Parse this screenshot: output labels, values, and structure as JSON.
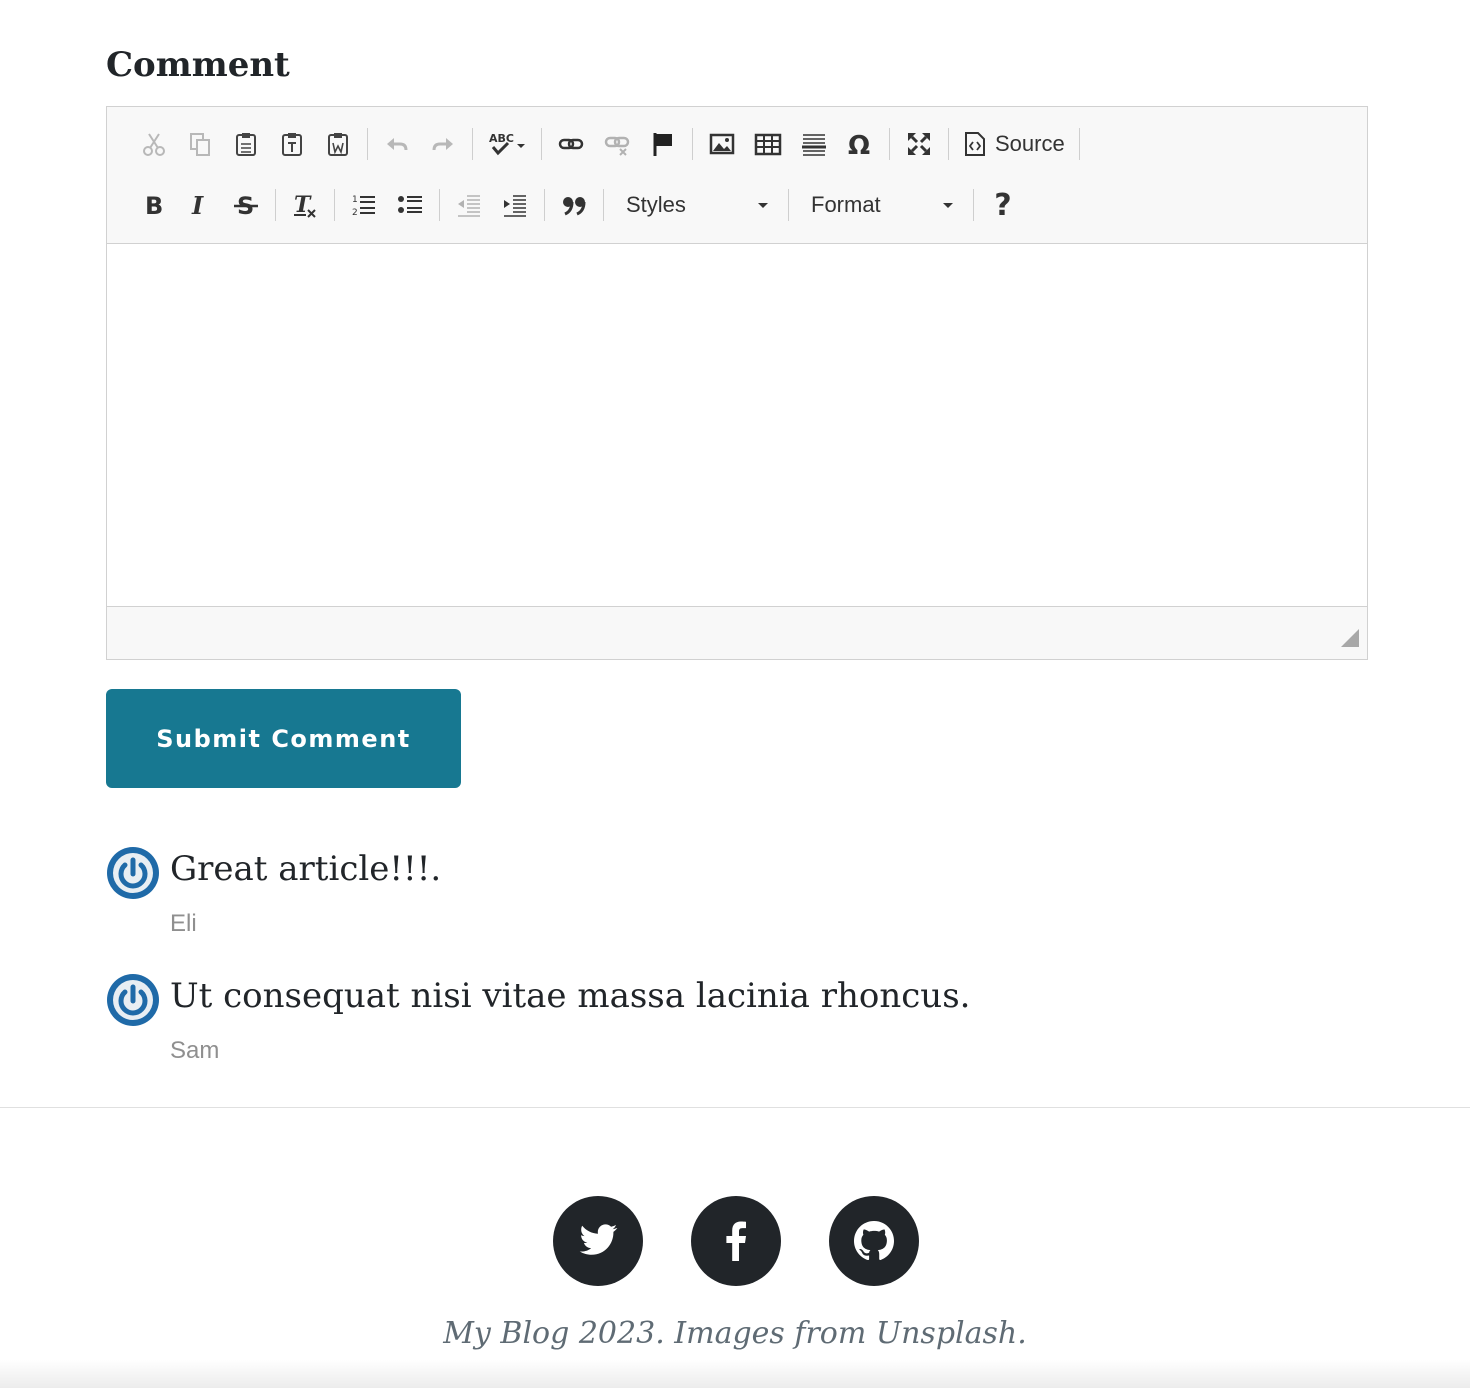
{
  "heading": "Comment",
  "toolbar": {
    "row1": [
      {
        "icon": "cut-icon",
        "disabled": true
      },
      {
        "icon": "copy-icon",
        "disabled": true
      },
      {
        "icon": "paste-icon"
      },
      {
        "icon": "paste-text-icon"
      },
      {
        "icon": "paste-from-word-icon"
      },
      {
        "icon": "undo-icon",
        "disabled": true
      },
      {
        "icon": "redo-icon",
        "disabled": true
      },
      {
        "icon": "spellcheck-icon"
      },
      {
        "icon": "link-icon"
      },
      {
        "icon": "unlink-icon",
        "disabled": true
      },
      {
        "icon": "anchor-icon"
      },
      {
        "icon": "image-icon"
      },
      {
        "icon": "table-icon"
      },
      {
        "icon": "horizontal-line-icon"
      },
      {
        "icon": "special-char-icon"
      },
      {
        "icon": "maximize-icon"
      }
    ],
    "source_label": "Source",
    "styles_label": "Styles",
    "format_label": "Format",
    "help_glyph": "?"
  },
  "editor": {
    "content": ""
  },
  "submit_label": "Submit Comment",
  "comments": [
    {
      "text": "Great article!!!.",
      "author": "Eli"
    },
    {
      "text": "Ut consequat nisi vitae massa lacinia rhoncus.",
      "author": "Sam"
    }
  ],
  "footer": {
    "social": [
      {
        "icon": "twitter-icon"
      },
      {
        "icon": "facebook-icon"
      },
      {
        "icon": "github-icon"
      }
    ],
    "copyright": "My Blog 2023. Images from Unsplash."
  },
  "colors": {
    "accent": "#177891",
    "avatar_blue": "#1f6aa8",
    "social_bg": "#212529",
    "author_text": "#8f8f8f"
  }
}
